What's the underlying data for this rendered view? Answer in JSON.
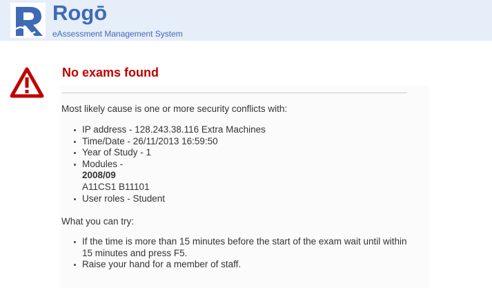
{
  "header": {
    "logo_letter": "R",
    "title": "Rogō",
    "subtitle": "eAssessment Management System"
  },
  "error": {
    "icon": "warning-triangle-icon",
    "title": "No exams found"
  },
  "content": {
    "intro": "Most likely cause is one or more security conflicts with:",
    "conflicts": {
      "ip": "IP address - 128.243.38.116 Extra Machines",
      "time": "Time/Date - 26/11/2013 16:59:50",
      "year": "Year of Study - 1",
      "modules_label": "Modules -",
      "modules_year": "2008/09",
      "modules_codes": "A11CS1 B11101",
      "roles": "User roles - Student"
    },
    "try_heading": "What you can try:",
    "try_items": {
      "wait_line1": "If the time is more than 15 minutes before the start of the exam wait until within",
      "wait_line2": "15 minutes and press F5.",
      "raise_hand": "Raise your hand for a member of staff."
    }
  },
  "colors": {
    "header_bg": "#e6eefa",
    "brand_blue": "#3f6bb4",
    "error_red": "#c00000",
    "text": "#333333"
  }
}
